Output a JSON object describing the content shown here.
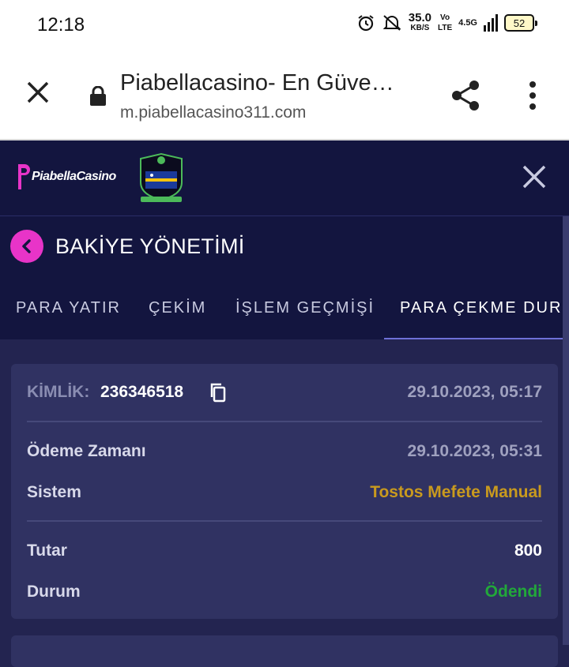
{
  "status_bar": {
    "time": "12:18",
    "speed_value": "35.0",
    "speed_unit": "KB/S",
    "network_top": "Vo",
    "network_bottom": "LTE",
    "signal_label": "4.5G",
    "battery": "52"
  },
  "browser": {
    "title": "Piabellacasino- En Güve…",
    "url": "m.piabellacasino311.com"
  },
  "site_header": {
    "logo_text": "PiabellaCasino",
    "badge_text": "CURAÇAO EGAMING",
    "accent_color": "#e834c8"
  },
  "section": {
    "title": "BAKİYE YÖNETİMİ"
  },
  "tabs": [
    {
      "label": "PARA YATIR",
      "active": false
    },
    {
      "label": "ÇEKİM",
      "active": false
    },
    {
      "label": "İŞLEM GEÇMİŞİ",
      "active": false
    },
    {
      "label": "PARA ÇEKME DURUM",
      "active": true
    }
  ],
  "transaction": {
    "id_label": "KİMLİK:",
    "id_value": "236346518",
    "created_at": "29.10.2023, 05:17",
    "payment_time_label": "Ödeme Zamanı",
    "payment_time_value": "29.10.2023, 05:31",
    "system_label": "Sistem",
    "system_value": "Tostos Mefete Manual",
    "amount_label": "Tutar",
    "amount_value": "800",
    "status_label": "Durum",
    "status_value": "Ödendi",
    "system_color": "#c99a1e",
    "status_color": "#22a83a"
  }
}
